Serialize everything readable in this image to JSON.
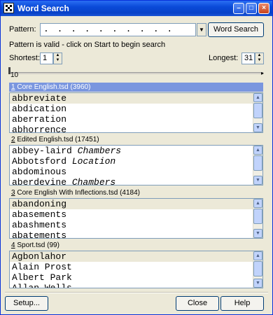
{
  "window": {
    "title": "Word Search"
  },
  "pattern": {
    "label": "Pattern:",
    "value": ". . . . . . . . . .",
    "search_button": "Word Search"
  },
  "status": "Pattern is valid - click on Start to begin search",
  "shortest": {
    "label": "Shortest:",
    "value": "1"
  },
  "longest": {
    "label": "Longest:",
    "value": "31"
  },
  "slider": {
    "value": "10"
  },
  "dictionaries": [
    {
      "index": "1",
      "name": "Core English.tsd (3960)",
      "rows": [
        {
          "word": "abbreviate",
          "note": ""
        },
        {
          "word": "abdication",
          "note": ""
        },
        {
          "word": "aberration",
          "note": ""
        },
        {
          "word": "abhorrence",
          "note": ""
        }
      ]
    },
    {
      "index": "2",
      "name": "Edited English.tsd (17451)",
      "rows": [
        {
          "word": "abbey-laird",
          "note": "Chambers"
        },
        {
          "word": "Abbotsford",
          "note": "Location"
        },
        {
          "word": "abdominous",
          "note": ""
        },
        {
          "word": "aberdevine",
          "note": "Chambers"
        }
      ]
    },
    {
      "index": "3",
      "name": "Core English With Inflections.tsd (4184)",
      "rows": [
        {
          "word": "abandoning",
          "note": ""
        },
        {
          "word": "abasements",
          "note": ""
        },
        {
          "word": "abashments",
          "note": ""
        },
        {
          "word": "abatements",
          "note": ""
        }
      ]
    },
    {
      "index": "4",
      "name": "Sport.tsd (99)",
      "rows": [
        {
          "word": "Agbonlahor",
          "note": ""
        },
        {
          "word": "Alain Prost",
          "note": ""
        },
        {
          "word": "Albert Park",
          "note": ""
        },
        {
          "word": "Allan Wells",
          "note": ""
        }
      ]
    }
  ],
  "footer": {
    "setup": "Setup...",
    "close": "Close",
    "help": "Help"
  },
  "colors": {
    "title_bar": "#0a4ad8",
    "selected_header": "#7a96df",
    "window_bg": "#ece9d8"
  }
}
